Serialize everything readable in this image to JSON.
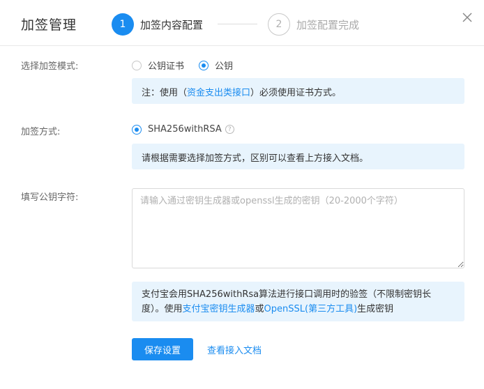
{
  "header": {
    "title": "加签管理",
    "steps": [
      {
        "number": "1",
        "label": "加签内容配置",
        "active": true
      },
      {
        "number": "2",
        "label": "加签配置完成",
        "active": false
      }
    ],
    "close_icon": "close-icon"
  },
  "mode": {
    "label": "选择加签模式:",
    "options": [
      {
        "label": "公钥证书",
        "checked": false
      },
      {
        "label": "公钥",
        "checked": true
      }
    ],
    "note_prefix": "注：使用（",
    "note_link": "资金支出类接口",
    "note_suffix": "）必须使用证书方式。"
  },
  "method": {
    "label": "加签方式:",
    "option": "SHA256withRSA",
    "help_icon": "question-circle-icon",
    "note": "请根据需要选择加签方式，区别可以查看上方接入文档。"
  },
  "public_key": {
    "label": "填写公钥字符:",
    "placeholder": "请输入通过密钥生成器或openssl生成的密钥（20-2000个字符）",
    "value": "",
    "note_line1": "支付宝会用SHA256withRsa算法进行接口调用时的验签（不限制密钥长",
    "note_line2_prefix": "度）。使用",
    "note_link1": "支付宝密钥生成器",
    "note_mid": "或",
    "note_link2": "OpenSSL(第三方工具)",
    "note_suffix": "生成密钥"
  },
  "actions": {
    "save_label": "保存设置",
    "doc_link": "查看接入文档"
  },
  "colors": {
    "accent": "#1a8cf0",
    "note_bg": "#e8f4fd"
  }
}
